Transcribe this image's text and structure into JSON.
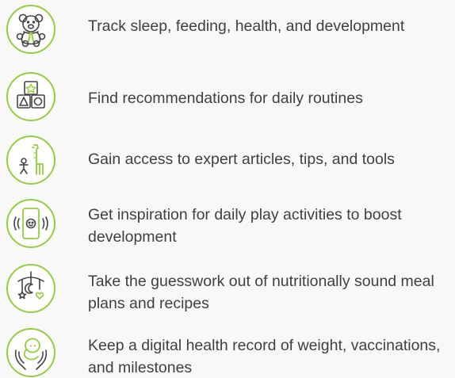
{
  "features": [
    {
      "icon": "teddy-bear-icon",
      "text": "Track sleep, feeding, health, and development"
    },
    {
      "icon": "toy-blocks-icon",
      "text": "Find recommendations for daily routines"
    },
    {
      "icon": "giraffe-growth-chart-icon",
      "text": "Gain access to expert articles, tips, and tools"
    },
    {
      "icon": "phone-baby-vibrate-icon",
      "text": "Get inspiration for daily play activities to boost development"
    },
    {
      "icon": "baby-mobile-icon",
      "text": "Take the guesswork out of nutritionally sound meal plans and recipes"
    },
    {
      "icon": "baby-in-hands-icon",
      "text": "Keep a digital health record of weight, vaccinations, and milestones"
    }
  ],
  "colors": {
    "accent": "#93cf3c",
    "text": "#404040",
    "icon_stroke": "#444444",
    "background": "#f8f8f8"
  }
}
